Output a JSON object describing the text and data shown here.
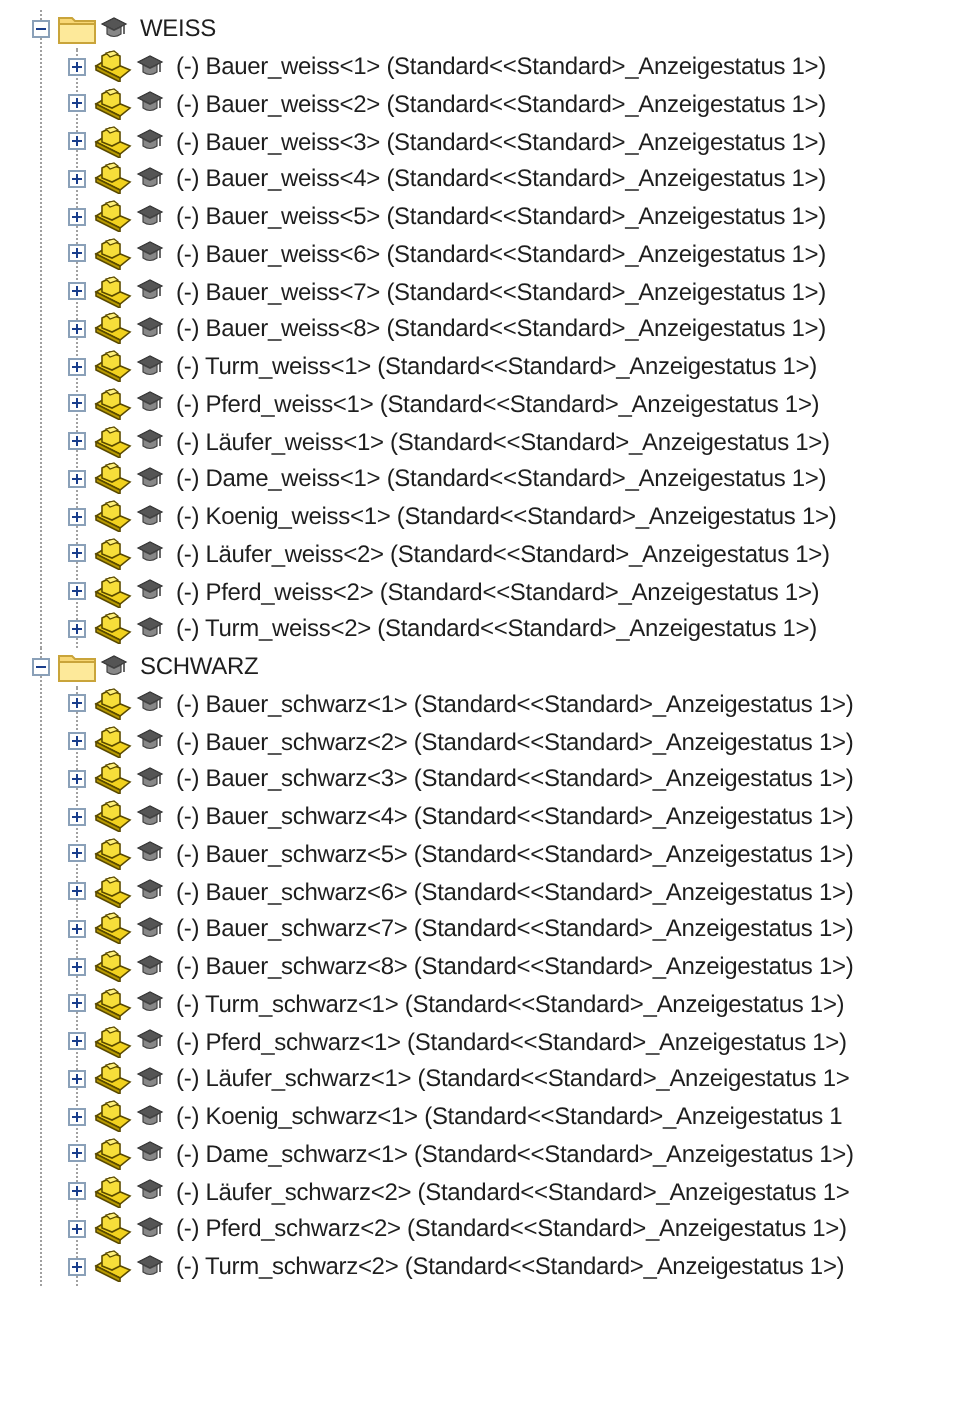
{
  "tree": [
    {
      "label": "WEISS",
      "expanded": true,
      "children": [
        {
          "label": "(-) Bauer_weiss<1> (Standard<<Standard>_Anzeigestatus 1>)",
          "expanded": false
        },
        {
          "label": "(-) Bauer_weiss<2> (Standard<<Standard>_Anzeigestatus 1>)",
          "expanded": false
        },
        {
          "label": "(-) Bauer_weiss<3> (Standard<<Standard>_Anzeigestatus 1>)",
          "expanded": false
        },
        {
          "label": "(-) Bauer_weiss<4> (Standard<<Standard>_Anzeigestatus 1>)",
          "expanded": false
        },
        {
          "label": "(-) Bauer_weiss<5> (Standard<<Standard>_Anzeigestatus 1>)",
          "expanded": false
        },
        {
          "label": "(-) Bauer_weiss<6> (Standard<<Standard>_Anzeigestatus 1>)",
          "expanded": false
        },
        {
          "label": "(-) Bauer_weiss<7> (Standard<<Standard>_Anzeigestatus 1>)",
          "expanded": false
        },
        {
          "label": "(-) Bauer_weiss<8> (Standard<<Standard>_Anzeigestatus 1>)",
          "expanded": false
        },
        {
          "label": "(-) Turm_weiss<1> (Standard<<Standard>_Anzeigestatus 1>)",
          "expanded": false
        },
        {
          "label": "(-) Pferd_weiss<1> (Standard<<Standard>_Anzeigestatus 1>)",
          "expanded": false
        },
        {
          "label": "(-) Läufer_weiss<1> (Standard<<Standard>_Anzeigestatus 1>)",
          "expanded": false
        },
        {
          "label": "(-) Dame_weiss<1> (Standard<<Standard>_Anzeigestatus 1>)",
          "expanded": false
        },
        {
          "label": "(-) Koenig_weiss<1> (Standard<<Standard>_Anzeigestatus 1>)",
          "expanded": false
        },
        {
          "label": "(-) Läufer_weiss<2> (Standard<<Standard>_Anzeigestatus 1>)",
          "expanded": false
        },
        {
          "label": "(-) Pferd_weiss<2> (Standard<<Standard>_Anzeigestatus 1>)",
          "expanded": false
        },
        {
          "label": "(-) Turm_weiss<2> (Standard<<Standard>_Anzeigestatus 1>)",
          "expanded": false
        }
      ]
    },
    {
      "label": "SCHWARZ",
      "expanded": true,
      "children": [
        {
          "label": "(-) Bauer_schwarz<1> (Standard<<Standard>_Anzeigestatus 1>)",
          "expanded": false
        },
        {
          "label": "(-) Bauer_schwarz<2> (Standard<<Standard>_Anzeigestatus 1>)",
          "expanded": false
        },
        {
          "label": "(-) Bauer_schwarz<3> (Standard<<Standard>_Anzeigestatus 1>)",
          "expanded": false
        },
        {
          "label": "(-) Bauer_schwarz<4> (Standard<<Standard>_Anzeigestatus 1>)",
          "expanded": false
        },
        {
          "label": "(-) Bauer_schwarz<5> (Standard<<Standard>_Anzeigestatus 1>)",
          "expanded": false
        },
        {
          "label": "(-) Bauer_schwarz<6> (Standard<<Standard>_Anzeigestatus 1>)",
          "expanded": false
        },
        {
          "label": "(-) Bauer_schwarz<7> (Standard<<Standard>_Anzeigestatus 1>)",
          "expanded": false
        },
        {
          "label": "(-) Bauer_schwarz<8> (Standard<<Standard>_Anzeigestatus 1>)",
          "expanded": false
        },
        {
          "label": "(-) Turm_schwarz<1> (Standard<<Standard>_Anzeigestatus 1>)",
          "expanded": false
        },
        {
          "label": "(-) Pferd_schwarz<1> (Standard<<Standard>_Anzeigestatus 1>)",
          "expanded": false
        },
        {
          "label": "(-) Läufer_schwarz<1> (Standard<<Standard>_Anzeigestatus 1>",
          "expanded": false
        },
        {
          "label": "(-) Koenig_schwarz<1> (Standard<<Standard>_Anzeigestatus 1",
          "expanded": false
        },
        {
          "label": "(-) Dame_schwarz<1> (Standard<<Standard>_Anzeigestatus 1>)",
          "expanded": false
        },
        {
          "label": "(-) Läufer_schwarz<2> (Standard<<Standard>_Anzeigestatus 1>",
          "expanded": false
        },
        {
          "label": "(-) Pferd_schwarz<2> (Standard<<Standard>_Anzeigestatus 1>)",
          "expanded": false
        },
        {
          "label": "(-) Turm_schwarz<2> (Standard<<Standard>_Anzeigestatus 1>)",
          "expanded": false
        }
      ]
    }
  ]
}
